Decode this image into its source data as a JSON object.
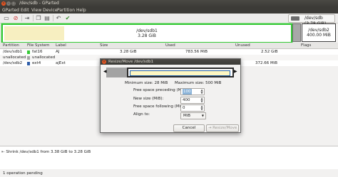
{
  "window": {
    "title": "/dev/sdb - GParted",
    "controls": [
      "close-icon",
      "minimize-icon",
      "maximize-icon"
    ]
  },
  "menu": [
    "GParted",
    "Edit",
    "View",
    "Device",
    "Partition",
    "Help"
  ],
  "toolbar": {
    "icons": [
      "new-icon",
      "delete-icon",
      "resize-move-icon",
      "copy-icon",
      "paste-icon",
      "undo-icon",
      "apply-icon"
    ]
  },
  "device_selector": {
    "icon": "disk-icon",
    "label": "/dev/sdb (3.78 GiB)"
  },
  "map": {
    "partitions": [
      {
        "name": "/dev/sdb1",
        "size": "3.28 GiB",
        "used_fraction": 0.21,
        "color": "#35c935",
        "selected": true
      },
      {
        "name": "/dev/sdb2",
        "size": "400.00 MiB",
        "used_fraction": 0.03,
        "color": "#3b3b3b",
        "selected": false
      }
    ]
  },
  "list": {
    "headers": [
      "Partition",
      "File System",
      "Label",
      "Size",
      "Used",
      "Unused",
      "Flags"
    ],
    "rows": [
      {
        "partition": "/dev/sdb1",
        "fs": "fat16",
        "fs_color": "#35c935",
        "label": "AJ",
        "size": "3.28 GiB",
        "used": "783.56 MiB",
        "unused": "2.52 GiB",
        "flags": ""
      },
      {
        "partition": "unallocated",
        "fs": "unallocated",
        "fs_color": "#a8a8a8",
        "label": "",
        "size": "",
        "used": "",
        "unused": "",
        "flags": ""
      },
      {
        "partition": "/dev/sdb2",
        "fs": "ext4",
        "fs_color": "#2e5da8",
        "label": "ajExt",
        "size": "",
        "used": "",
        "unused": "372.66 MiB",
        "flags": ""
      }
    ]
  },
  "dialog": {
    "title": "Resize/Move /dev/sdb1",
    "min_label": "Minimum size: 28 MiB",
    "max_label": "Maximum size: 500 MiB",
    "fields": [
      {
        "label": "Free space preceding (MiB):",
        "value": "100",
        "selected": true
      },
      {
        "label": "New size (MiB):",
        "value": "400",
        "selected": false
      },
      {
        "label": "Free space following (MiB):",
        "value": "0",
        "selected": false
      }
    ],
    "align_label": "Align to:",
    "align_value": "MiB",
    "cancel_label": "Cancel",
    "confirm_label": "Resize/Move"
  },
  "operations": {
    "items": [
      "Shrink /dev/sdb1 from 3.38 GiB to 3.28 GiB"
    ]
  },
  "status": "1 operation pending"
}
